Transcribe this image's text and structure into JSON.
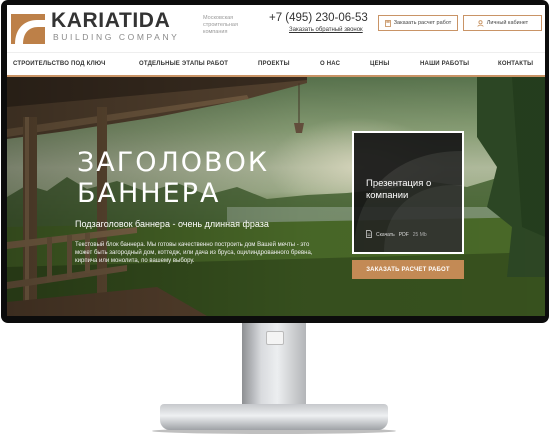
{
  "brand": {
    "name": "KARIATIDA",
    "subtitle": "BUILDING COMPANY",
    "tagline": "Московская строительная компания",
    "accent": "#c38a55"
  },
  "header": {
    "phone": "+7 (495) 230-06-53",
    "callback_link": "Заказать обратный звонок",
    "calc_button": "Заказать расчет работ",
    "cabinet_button": "Личный кабинет"
  },
  "nav": {
    "items": [
      {
        "label": "СТРОИТЕЛЬСТВО ПОД КЛЮЧ"
      },
      {
        "label": "ОТДЕЛЬНЫЕ ЭТАПЫ РАБОТ"
      },
      {
        "label": "ПРОЕКТЫ"
      },
      {
        "label": "О НАС"
      },
      {
        "label": "ЦЕНЫ"
      },
      {
        "label": "НАШИ РАБОТЫ"
      },
      {
        "label": "КОНТАКТЫ"
      }
    ]
  },
  "hero": {
    "title": "ЗАГОЛОВОК БАННЕРА",
    "subtitle": "Подзаголовок баннера - очень длинная фраза",
    "text": "Текстовый блок баннера. Мы готовы качественно построить дом Вашей мечты - это может быть загородный дом, коттедж, или дача из бруса, оцилиндрованного бревна, кирпича или монолита, по вашему выбору.",
    "presentation": {
      "title": "Презентация о компании",
      "download_label": "Скачать",
      "file_type": "PDF",
      "file_size": "25 Mb"
    },
    "cta": "ЗАКАЗАТЬ РАСЧЕТ РАБОТ"
  },
  "icons": {
    "logo": "caryatid-arc-logo",
    "calc": "calculator-icon",
    "cabinet": "user-icon",
    "file": "document-icon"
  }
}
